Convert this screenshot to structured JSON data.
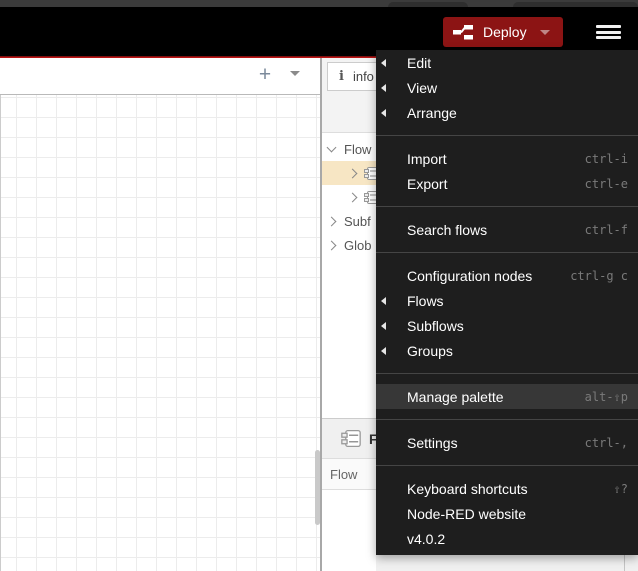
{
  "colors": {
    "deploy_red": "#8C1414",
    "header_black": "#000000",
    "accent_red_line": "#bb1414",
    "menu_bg": "#1e1e1e",
    "menu_highlight_bg": "#373737",
    "tree_selected_bg": "#f7e6c4"
  },
  "header": {
    "deploy_label": "Deploy"
  },
  "workspace": {
    "add_tab_label": "+"
  },
  "sidebar": {
    "tab_label": "info",
    "tab_icon_glyph": "i",
    "tree": [
      {
        "label": "Flow",
        "state": "expanded"
      },
      {
        "label": "",
        "state": "collapsed",
        "selected": true,
        "icon": "flow-node"
      },
      {
        "label": "",
        "state": "collapsed",
        "icon": "flow-node"
      },
      {
        "label": "Subf",
        "state": "collapsed"
      },
      {
        "label": "Glob",
        "state": "collapsed"
      }
    ],
    "detail": {
      "title": "F",
      "row_label": "Flow"
    }
  },
  "menu": {
    "items": [
      {
        "label": "Edit",
        "submenu": true
      },
      {
        "label": "View",
        "submenu": true
      },
      {
        "label": "Arrange",
        "submenu": true
      },
      {
        "label": "Import",
        "shortcut": "ctrl-i"
      },
      {
        "label": "Export",
        "shortcut": "ctrl-e"
      },
      {
        "label": "Search flows",
        "shortcut": "ctrl-f"
      },
      {
        "label": "Configuration nodes",
        "shortcut": "ctrl-g c"
      },
      {
        "label": "Flows",
        "submenu": true
      },
      {
        "label": "Subflows",
        "submenu": true
      },
      {
        "label": "Groups",
        "submenu": true
      },
      {
        "label": "Manage palette",
        "shortcut": "alt-⇧p",
        "highlighted": true
      },
      {
        "label": "Settings",
        "shortcut": "ctrl-,"
      },
      {
        "label": "Keyboard shortcuts",
        "shortcut": "⇧?"
      },
      {
        "label": "Node-RED website"
      },
      {
        "label": "v4.0.2"
      }
    ]
  }
}
